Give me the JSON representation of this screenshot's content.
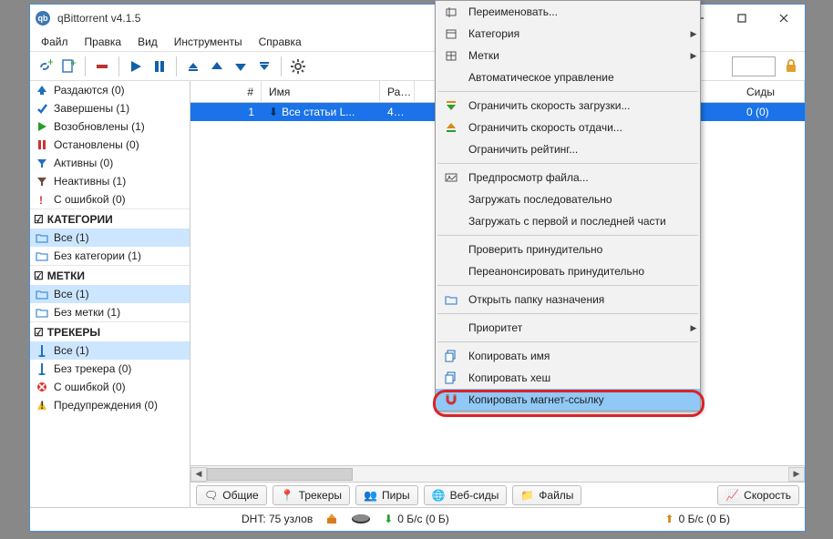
{
  "window": {
    "title": "qBittorrent v4.1.5"
  },
  "menubar": [
    "Файл",
    "Правка",
    "Вид",
    "Инструменты",
    "Справка"
  ],
  "sidebar": {
    "status_filters": [
      {
        "label": "Раздаются (0)",
        "icon": "up-blue"
      },
      {
        "label": "Завершены (1)",
        "icon": "check-blue"
      },
      {
        "label": "Возобновлены (1)",
        "icon": "play-green"
      },
      {
        "label": "Остановлены (0)",
        "icon": "pause-red"
      },
      {
        "label": "Активны (0)",
        "icon": "filter-blue"
      },
      {
        "label": "Неактивны (1)",
        "icon": "filter-grey"
      },
      {
        "label": "С ошибкой (0)",
        "icon": "warn-red"
      }
    ],
    "categories_hdr": "КАТЕГОРИИ",
    "categories": [
      {
        "label": "Все (1)",
        "sel": true
      },
      {
        "label": "Без категории (1)"
      }
    ],
    "tags_hdr": "МЕТКИ",
    "tags": [
      {
        "label": "Все (1)",
        "sel": true
      },
      {
        "label": "Без метки (1)"
      }
    ],
    "trackers_hdr": "ТРЕКЕРЫ",
    "trackers": [
      {
        "label": "Все (1)",
        "sel": true,
        "icon": "tracker"
      },
      {
        "label": "Без трекера (0)",
        "icon": "tracker"
      },
      {
        "label": "С ошибкой (0)",
        "icon": "error-red"
      },
      {
        "label": "Предупреждения (0)",
        "icon": "warn-yellow"
      }
    ]
  },
  "list": {
    "cols": {
      "num": "#",
      "name": "Имя",
      "size": "Ра…",
      "seeds": "Сиды"
    },
    "row": {
      "num": "1",
      "name": "Все статьи L...",
      "size": "4…",
      "seeds": "0 (0)"
    }
  },
  "tabs": {
    "general": "Общие",
    "trackers": "Трекеры",
    "peers": "Пиры",
    "webseeds": "Веб-сиды",
    "files": "Файлы",
    "speed": "Скорость"
  },
  "status": {
    "dht": "DHT: 75 узлов",
    "down": "0 Б/с (0 Б)",
    "up": "0 Б/с (0 Б)"
  },
  "context_menu": [
    {
      "label": "Переименовать...",
      "icon": "rename"
    },
    {
      "label": "Категория",
      "icon": "cat",
      "submenu": true
    },
    {
      "label": "Метки",
      "icon": "tag",
      "submenu": true
    },
    {
      "label": "Автоматическое управление"
    },
    {
      "divider": true
    },
    {
      "label": "Ограничить скорость загрузки...",
      "icon": "limit-down"
    },
    {
      "label": "Ограничить скорость отдачи...",
      "icon": "limit-up"
    },
    {
      "label": "Ограничить рейтинг..."
    },
    {
      "divider": true
    },
    {
      "label": "Предпросмотр файла...",
      "icon": "preview"
    },
    {
      "label": "Загружать последовательно"
    },
    {
      "label": "Загружать с первой и последней части"
    },
    {
      "divider": true
    },
    {
      "label": "Проверить принудительно"
    },
    {
      "label": "Переанонсировать принудительно"
    },
    {
      "divider": true
    },
    {
      "label": "Открыть папку назначения",
      "icon": "folder"
    },
    {
      "divider": true
    },
    {
      "label": "Приоритет",
      "submenu": true
    },
    {
      "divider": true
    },
    {
      "label": "Копировать имя",
      "icon": "copy"
    },
    {
      "label": "Копировать хеш",
      "icon": "copy"
    },
    {
      "label": "Копировать магнет-ссылку",
      "icon": "magnet",
      "highlight": true
    }
  ]
}
